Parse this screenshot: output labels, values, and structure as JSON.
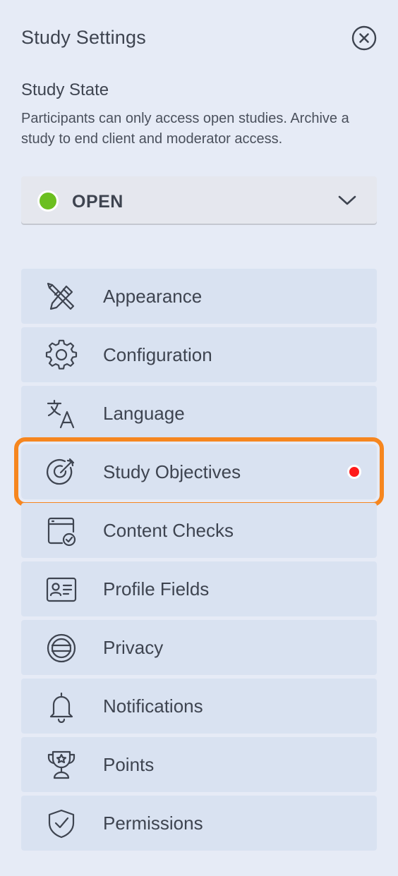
{
  "header": {
    "title": "Study Settings",
    "close_icon": "close-circle-icon"
  },
  "study_state": {
    "title": "Study State",
    "description": "Participants can only access open studies. Archive a study to end client and moderator access.",
    "selected_value": "OPEN",
    "status_color": "#6bbf1f"
  },
  "menu": {
    "items": [
      {
        "label": "Appearance",
        "icon": "brush-pencil-icon"
      },
      {
        "label": "Configuration",
        "icon": "gear-icon"
      },
      {
        "label": "Language",
        "icon": "translate-icon"
      },
      {
        "label": "Study Objectives",
        "icon": "target-icon",
        "highlighted": true,
        "notification": true
      },
      {
        "label": "Content Checks",
        "icon": "calendar-check-icon"
      },
      {
        "label": "Profile Fields",
        "icon": "id-card-icon"
      },
      {
        "label": "Privacy",
        "icon": "privacy-icon"
      },
      {
        "label": "Notifications",
        "icon": "bell-icon"
      },
      {
        "label": "Points",
        "icon": "trophy-star-icon"
      },
      {
        "label": "Permissions",
        "icon": "shield-check-icon"
      }
    ]
  },
  "colors": {
    "highlight_outline": "#f6861f",
    "notification_dot": "#ff1a1a",
    "background": "#e6ebf6",
    "menu_item_bg": "#d9e2f1"
  }
}
